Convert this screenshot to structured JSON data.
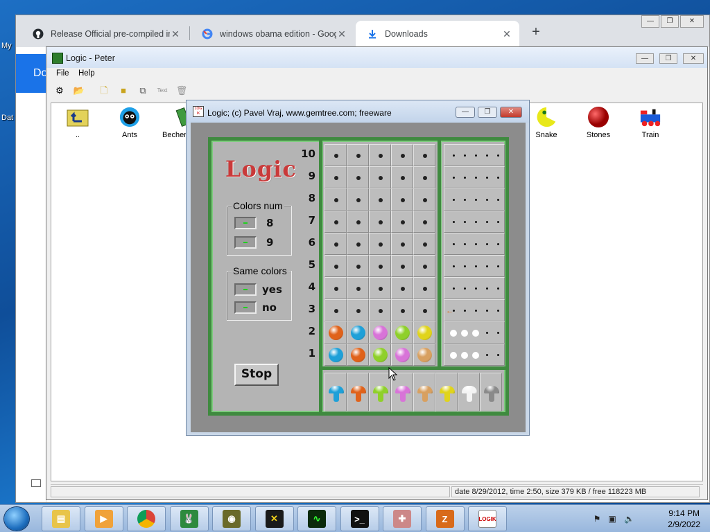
{
  "desktop": {
    "icon_labels": [
      "My",
      "Dat"
    ]
  },
  "chrome": {
    "tabs": [
      {
        "title": "Release Official pre-compiled ins",
        "icon": "github-icon"
      },
      {
        "title": "windows obama edition - Google",
        "icon": "google-icon"
      },
      {
        "title": "Downloads",
        "icon": "download-icon",
        "active": true
      }
    ],
    "new_tab_label": "+",
    "back_label": "←",
    "page_band_text": "Do"
  },
  "peter": {
    "title": "Logic - Peter",
    "menu": [
      "File",
      "Help"
    ],
    "toolbar_text_button": "Text",
    "files": [
      {
        "label": "..",
        "icon": "folder-up-icon"
      },
      {
        "label": "Ants",
        "icon": "ant-icon"
      },
      {
        "label": "Becher",
        "icon": "becher-icon"
      },
      {
        "label": "Snake",
        "icon": "snake-icon"
      },
      {
        "label": "Stones",
        "icon": "stone-icon"
      },
      {
        "label": "Train",
        "icon": "train-icon"
      }
    ],
    "status": "date 8/29/2012, time 2:50, size 379 KB / free 118223 MB"
  },
  "logic": {
    "title": "Logic;   (c) Pavel Vraj, www.gemtree.com;   freeware",
    "logo_text": "Logic",
    "colors_num": {
      "title": "Colors num",
      "options": [
        "8",
        "9"
      ]
    },
    "same_colors": {
      "title": "Same colors",
      "options": [
        "yes",
        "no"
      ]
    },
    "stop_label": "Stop",
    "row_numbers": [
      "10",
      "9",
      "8",
      "7",
      "6",
      "5",
      "4",
      "3",
      "2",
      "1"
    ],
    "guesses": {
      "2": [
        "#e0621a",
        "#1ea0d8",
        "#d874d8",
        "#8fd02a",
        "#e0d41c"
      ],
      "1": [
        "#1ea0d8",
        "#e0621a",
        "#8fd02a",
        "#d874d8",
        "#d8a060"
      ]
    },
    "hints": {
      "2": {
        "white": 3
      },
      "1": {
        "white": 3
      }
    },
    "palette": [
      "#1ea0d8",
      "#e0621a",
      "#8fd02a",
      "#d874d8",
      "#d8a060",
      "#e0d41c",
      "#f4f4f4",
      "#8a8a8a"
    ]
  },
  "taskbar": {
    "apps": [
      "explorer-icon",
      "media-player-icon",
      "chrome-icon",
      "bunny-game-icon",
      "alien-game-icon",
      "x-game-icon",
      "oscilloscope-icon",
      "cmd-icon",
      "cross-game-icon",
      "z-game-icon",
      "logik-icon"
    ],
    "logik_label": "LOGIK",
    "time": "9:14 PM",
    "date": "2/9/2022"
  }
}
